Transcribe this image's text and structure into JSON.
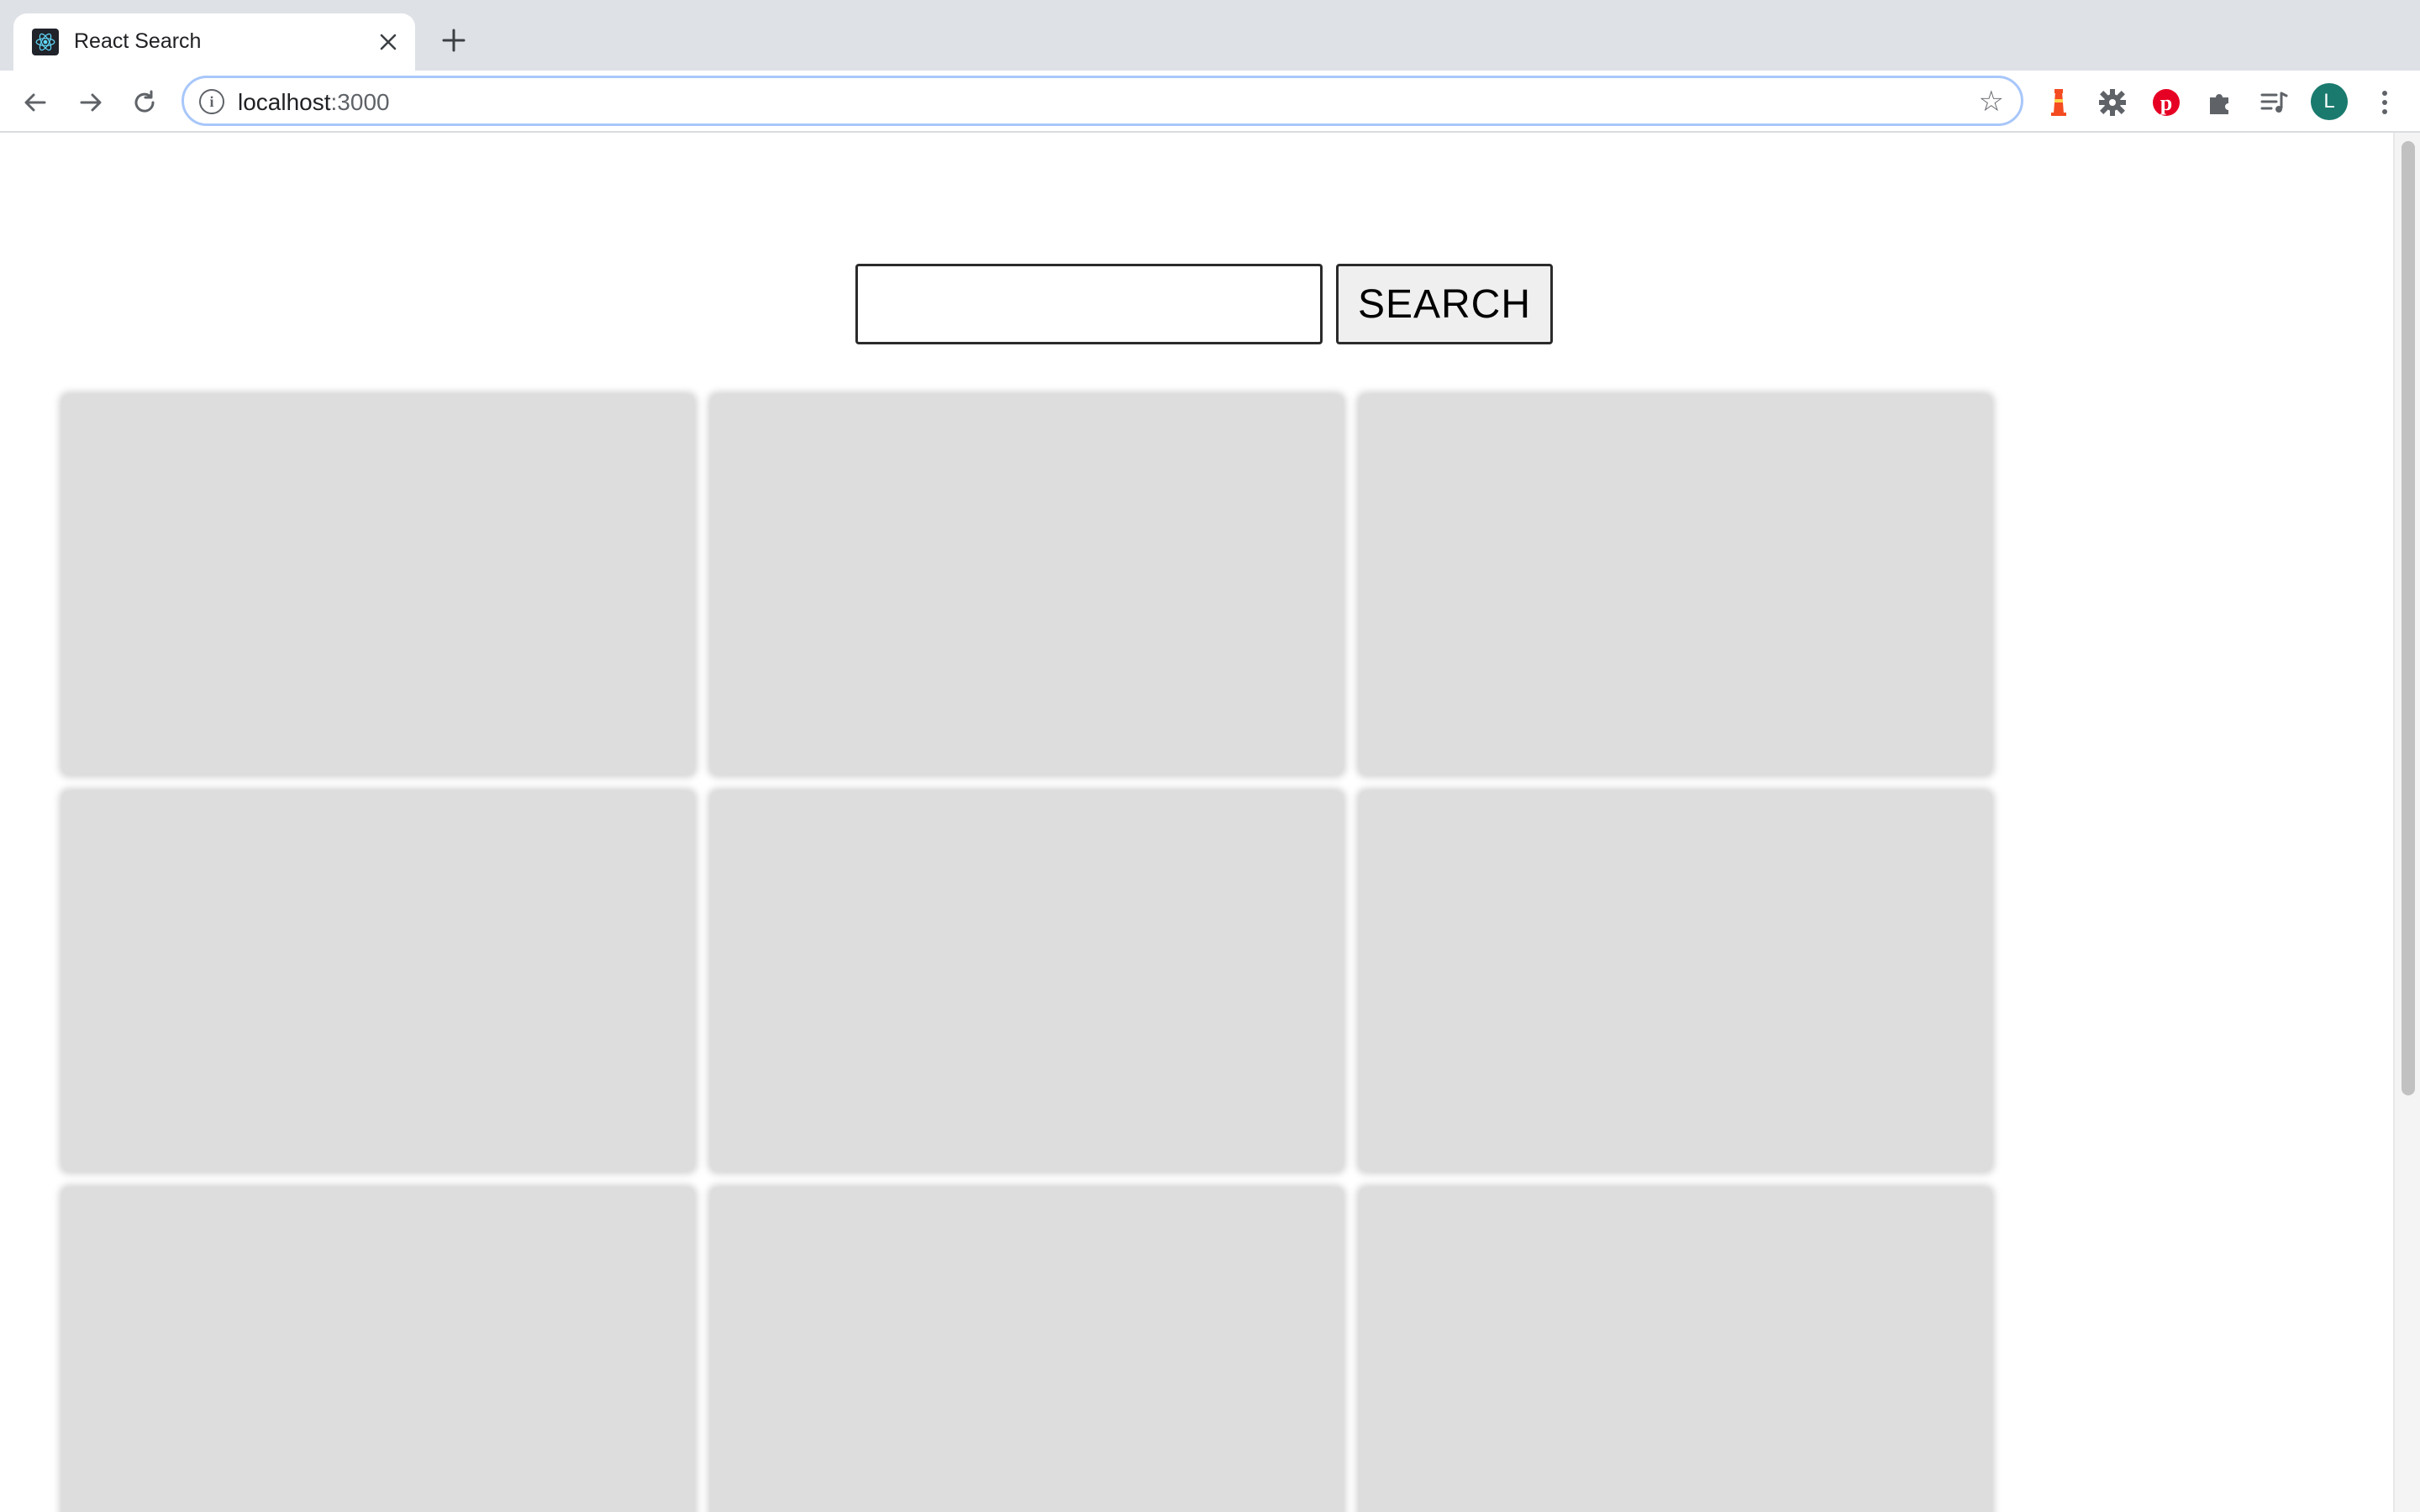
{
  "browser": {
    "tab": {
      "title": "React Search",
      "favicon": "react-logo-icon"
    },
    "address_bar": {
      "host": "localhost",
      "port": ":3000"
    },
    "extensions": [
      "lighthouse-icon",
      "gear-extension-icon",
      "pinterest-icon",
      "puzzle-extensions-icon",
      "reading-list-icon"
    ],
    "profile_initial": "L",
    "colors": {
      "avatar": "#1a7a6e",
      "pinterest": "#e60023",
      "lighthouse": "#f44b21",
      "focus_ring": "#a8c7fa"
    }
  },
  "page": {
    "search": {
      "input_value": "",
      "button_label": "SEARCH"
    },
    "results": {
      "placeholder_cards": 9,
      "card_color": "#dddddd"
    }
  }
}
